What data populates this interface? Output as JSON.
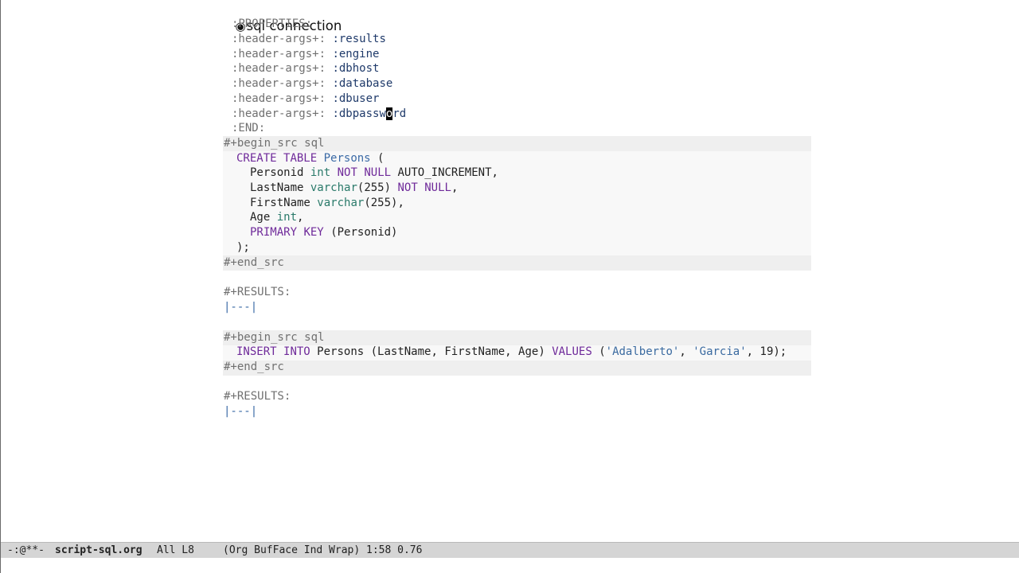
{
  "heading": {
    "bullet": "◉",
    "title": "sql connection"
  },
  "properties": {
    "open": ":PROPERTIES:",
    "rows": [
      {
        "key": ":header-args+:",
        "value": ":results"
      },
      {
        "key": ":header-args+:",
        "value": ":engine"
      },
      {
        "key": ":header-args+:",
        "value": ":dbhost"
      },
      {
        "key": ":header-args+:",
        "value": ":database"
      },
      {
        "key": ":header-args+:",
        "value": ":dbuser"
      },
      {
        "key": ":header-args+:",
        "value_before_cursor": ":dbpassw",
        "cursor_char": "o",
        "value_after_cursor": "rd"
      }
    ],
    "close": ":END:"
  },
  "block1": {
    "begin": "#+begin_src sql",
    "code": {
      "l1": {
        "kw1": "CREATE",
        "kw2": "TABLE",
        "name": "Persons",
        "rest": " ("
      },
      "l2": {
        "col": "Personid",
        "type": "int",
        "kw1": "NOT",
        "kw2": "NULL",
        "rest": "AUTO_INCREMENT,"
      },
      "l3": {
        "col": "LastName",
        "type": "varchar",
        "rest1": "(255)",
        "kw1": "NOT",
        "kw2": "NULL",
        "rest2": ","
      },
      "l4": {
        "col": "FirstName",
        "type": "varchar",
        "rest": "(255),"
      },
      "l5": {
        "col": "Age",
        "type": "int",
        "rest": ","
      },
      "l6": {
        "kw1": "PRIMARY",
        "kw2": "KEY",
        "rest": "(Personid)"
      },
      "l7": ");"
    },
    "end": "#+end_src",
    "results_label": "#+RESULTS:",
    "results_table": "|---|"
  },
  "block2": {
    "begin": "#+begin_src sql",
    "code": {
      "kw1": "INSERT",
      "kw2": "INTO",
      "mid": "Persons (LastName, FirstName, Age)",
      "kw3": "VALUES",
      "open": "(",
      "s1": "'Adalberto'",
      "sep": ", ",
      "s2": "'Garcia'",
      "tail": ", 19);"
    },
    "end": "#+end_src",
    "results_label": "#+RESULTS:",
    "results_table": "|---|"
  },
  "modeline": {
    "status": "-:@**-",
    "buffer_name": "script-sql.org",
    "position": "All L8",
    "modes": "(Org BufFace Ind Wrap) 1:58 0.76"
  }
}
